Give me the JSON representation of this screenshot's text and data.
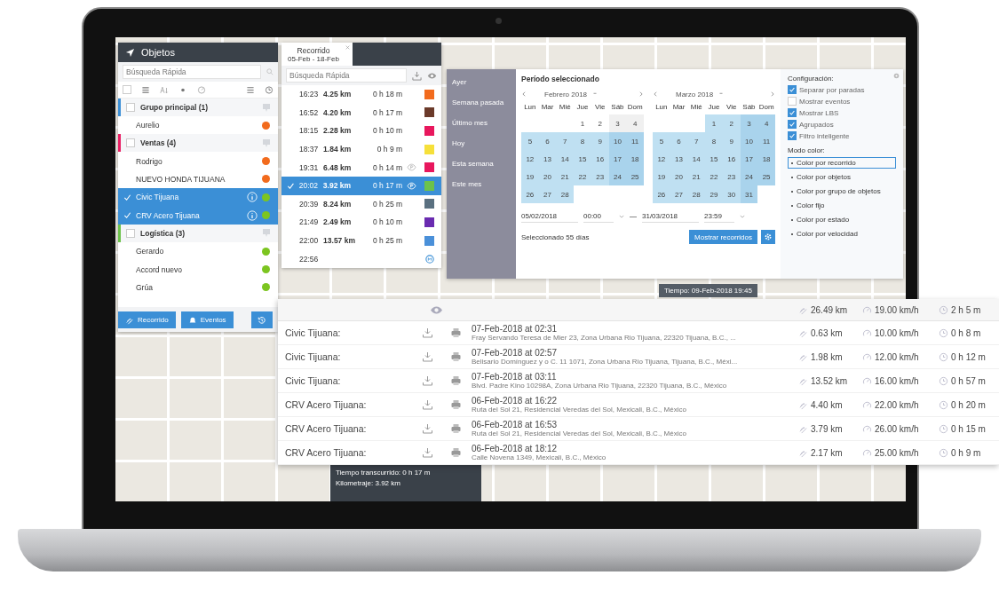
{
  "objects_panel": {
    "title": "Objetos",
    "search": {
      "placeholder": "Búsqueda Rápida"
    },
    "select_all": {
      "checked": false
    },
    "groups": [
      {
        "name": "Grupo principal (1)",
        "color": "#3b8fd6",
        "checked": false,
        "children": [
          {
            "name": "Aurelio",
            "color": "#f26b1d",
            "selected": false
          }
        ]
      },
      {
        "name": "Ventas (4)",
        "color": "#e91e63",
        "checked": false,
        "children": [
          {
            "name": "Rodrigo",
            "color": "#f26b1d",
            "selected": false
          },
          {
            "name": "NUEVO HONDA TIJUANA",
            "color": "#f26b1d",
            "selected": false
          },
          {
            "name": "Civic Tijuana",
            "color": "#7cc520",
            "selected": true
          },
          {
            "name": "CRV Acero Tijuana",
            "color": "#7cc520",
            "selected": true
          }
        ]
      },
      {
        "name": "Logística (3)",
        "color": "#6cc24a",
        "checked": false,
        "children": [
          {
            "name": "Gerardo",
            "color": "#7cc520",
            "selected": false
          },
          {
            "name": "Accord nuevo",
            "color": "#7cc520",
            "selected": false
          },
          {
            "name": "Grúa",
            "color": "#7cc520",
            "selected": false
          }
        ]
      }
    ],
    "buttons": [
      "Recorrido",
      "Eventos"
    ]
  },
  "route_panel": {
    "tab": {
      "title": "Recorrido",
      "subtitle": "05-Feb - 18-Feb"
    },
    "search": {
      "placeholder": "Búsqueda Rápida"
    },
    "rows": [
      {
        "kind": "trip",
        "time": "16:23",
        "distance": "4.25 km",
        "duration": "0 h 18 m",
        "color": "#f26b1d",
        "selected": false,
        "stop_icon": false
      },
      {
        "kind": "trip",
        "time": "16:52",
        "distance": "4.20 km",
        "duration": "0 h 17 m",
        "color": "#6b3a2a",
        "selected": false,
        "stop_icon": false
      },
      {
        "kind": "trip",
        "time": "18:15",
        "distance": "2.28 km",
        "duration": "0 h 10 m",
        "color": "#e8175d",
        "selected": false,
        "stop_icon": false
      },
      {
        "kind": "trip",
        "time": "18:37",
        "distance": "1.84 km",
        "duration": "0 h 9 m",
        "color": "#f6e03a",
        "selected": false,
        "stop_icon": false
      },
      {
        "kind": "trip",
        "time": "19:31",
        "distance": "6.48 km",
        "duration": "0 h 14 m",
        "color": "#e8175d",
        "selected": false,
        "stop_icon": true
      },
      {
        "kind": "trip",
        "time": "20:02",
        "distance": "3.92 km",
        "duration": "0 h 17 m",
        "color": "#6cc24a",
        "selected": true,
        "stop_icon": true
      },
      {
        "kind": "trip",
        "time": "20:39",
        "distance": "8.24 km",
        "duration": "0 h 25 m",
        "color": "#5a7080",
        "selected": false,
        "stop_icon": false
      },
      {
        "kind": "trip",
        "time": "21:49",
        "distance": "2.49 km",
        "duration": "0 h 10 m",
        "color": "#6a2bb0",
        "selected": false,
        "stop_icon": false
      },
      {
        "kind": "trip",
        "time": "22:00",
        "distance": "13.57 km",
        "duration": "0 h 25 m",
        "color": "#4a90d9",
        "selected": false,
        "stop_icon": false
      },
      {
        "kind": "end",
        "time": "22:56"
      }
    ]
  },
  "date_picker": {
    "presets": [
      "Ayer",
      "Semana pasada",
      "Último mes",
      "Hoy",
      "Esta semana",
      "Este mes"
    ],
    "title": "Período seleccionado",
    "months": [
      {
        "name": "Febrero 2018",
        "weekdays": [
          "Lun",
          "Mar",
          "Mié",
          "Jue",
          "Vie",
          "Sáb",
          "Dom"
        ],
        "weeks": [
          [
            {
              "day": "1",
              "in_range": false
            },
            {
              "day": "2",
              "in_range": false
            },
            {
              "day": "3",
              "in_range": false
            },
            {
              "day": "4",
              "in_range": false
            }
          ],
          [
            {
              "day": "5",
              "in_range": true
            },
            {
              "day": "6",
              "in_range": true
            },
            {
              "day": "7",
              "in_range": true
            },
            {
              "day": "8",
              "in_range": true
            },
            {
              "day": "9",
              "in_range": true
            },
            {
              "day": "10",
              "in_range": true
            },
            {
              "day": "11",
              "in_range": true
            }
          ],
          [
            {
              "day": "12",
              "in_range": true
            },
            {
              "day": "13",
              "in_range": true
            },
            {
              "day": "14",
              "in_range": true
            },
            {
              "day": "15",
              "in_range": true
            },
            {
              "day": "16",
              "in_range": true
            },
            {
              "day": "17",
              "in_range": true
            },
            {
              "day": "18",
              "in_range": true
            }
          ],
          [
            {
              "day": "19",
              "in_range": true
            },
            {
              "day": "20",
              "in_range": true
            },
            {
              "day": "21",
              "in_range": true
            },
            {
              "day": "22",
              "in_range": true
            },
            {
              "day": "23",
              "in_range": true
            },
            {
              "day": "24",
              "in_range": true
            },
            {
              "day": "25",
              "in_range": true
            }
          ],
          [
            {
              "day": "26",
              "in_range": true
            },
            {
              "day": "27",
              "in_range": true
            },
            {
              "day": "28",
              "in_range": true
            }
          ]
        ]
      },
      {
        "name": "Marzo 2018",
        "weekdays": [
          "Lun",
          "Mar",
          "Mié",
          "Jue",
          "Vie",
          "Sáb",
          "Dom"
        ],
        "weeks": [
          [
            {
              "day": "1",
              "in_range": true
            },
            {
              "day": "2",
              "in_range": true
            },
            {
              "day": "3",
              "in_range": true
            },
            {
              "day": "4",
              "in_range": true
            }
          ],
          [
            {
              "day": "5",
              "in_range": true
            },
            {
              "day": "6",
              "in_range": true
            },
            {
              "day": "7",
              "in_range": true
            },
            {
              "day": "8",
              "in_range": true
            },
            {
              "day": "9",
              "in_range": true
            },
            {
              "day": "10",
              "in_range": true
            },
            {
              "day": "11",
              "in_range": true
            }
          ],
          [
            {
              "day": "12",
              "in_range": true
            },
            {
              "day": "13",
              "in_range": true
            },
            {
              "day": "14",
              "in_range": true
            },
            {
              "day": "15",
              "in_range": true
            },
            {
              "day": "16",
              "in_range": true
            },
            {
              "day": "17",
              "in_range": true
            },
            {
              "day": "18",
              "in_range": true
            }
          ],
          [
            {
              "day": "19",
              "in_range": true
            },
            {
              "day": "20",
              "in_range": true
            },
            {
              "day": "21",
              "in_range": true
            },
            {
              "day": "22",
              "in_range": true
            },
            {
              "day": "23",
              "in_range": true
            },
            {
              "day": "24",
              "in_range": true
            },
            {
              "day": "25",
              "in_range": true
            }
          ],
          [
            {
              "day": "26",
              "in_range": true
            },
            {
              "day": "27",
              "in_range": true
            },
            {
              "day": "28",
              "in_range": true
            },
            {
              "day": "29",
              "in_range": true
            },
            {
              "day": "30",
              "in_range": true
            },
            {
              "day": "31",
              "in_range": true
            }
          ]
        ]
      }
    ],
    "start": {
      "date": "05/02/2018",
      "time": "00:00"
    },
    "end": {
      "date": "31/03/2018",
      "time": "23:59"
    },
    "summary": "Seleccionado 55 días",
    "button": "Mostrar recorridos",
    "config": {
      "title": "Configuración:",
      "options": [
        {
          "label": "Separar por paradas",
          "checked": true
        },
        {
          "label": "Mostrar eventos",
          "checked": false
        },
        {
          "label": "Mostrar LBS",
          "checked": true
        },
        {
          "label": "Agrupados",
          "checked": true
        },
        {
          "label": "Filtro inteligente",
          "checked": true
        }
      ],
      "color_mode_title": "Modo color:",
      "color_modes": [
        {
          "label": "Color por recorrido",
          "selected": true
        },
        {
          "label": "Color por objetos",
          "selected": false
        },
        {
          "label": "Color por grupo de objetos",
          "selected": false
        },
        {
          "label": "Color fijo",
          "selected": false
        },
        {
          "label": "Color por estado",
          "selected": false
        },
        {
          "label": "Color por velocidad",
          "selected": false
        }
      ]
    }
  },
  "tooltip": "Tiempo: 09-Feb-2018 19:45",
  "trip_info": [
    "Tiempo transcurrido: 0 h 17 m",
    "Kilometraje: 3.92 km"
  ],
  "events_table": {
    "totals": {
      "distance": "26.49 km",
      "speed": "19.00 km/h",
      "duration": "2 h 5 m"
    },
    "rows": [
      {
        "object": "Civic Tijuana:",
        "date": "07-Feb-2018 at 02:31",
        "address": "Fray Servando Teresa de Mier 23, Zona Urbana Rio Tijuana, 22320 Tijuana, B.C., ...",
        "distance": "0.63 km",
        "speed": "10.00 km/h",
        "duration": "0 h 8 m"
      },
      {
        "object": "Civic Tijuana:",
        "date": "07-Feb-2018 at 02:57",
        "address": "Belisario Domínguez y o C. 11 1071, Zona Urbana Rio Tijuana, Tijuana, B.C., Méxi...",
        "distance": "1.98 km",
        "speed": "12.00 km/h",
        "duration": "0 h 12 m"
      },
      {
        "object": "Civic Tijuana:",
        "date": "07-Feb-2018 at 03:11",
        "address": "Blvd. Padre Kino 10298A, Zona Urbana Rio Tijuana, 22320 Tijuana, B.C., México",
        "distance": "13.52 km",
        "speed": "16.00 km/h",
        "duration": "0 h 57 m"
      },
      {
        "object": "CRV Acero Tijuana:",
        "date": "06-Feb-2018 at 16:22",
        "address": "Ruta del Sol 21, Residencial Veredas del Sol, Mexicali, B.C., México",
        "distance": "4.40 km",
        "speed": "22.00 km/h",
        "duration": "0 h 20 m"
      },
      {
        "object": "CRV Acero Tijuana:",
        "date": "06-Feb-2018 at 16:53",
        "address": "Ruta del Sol 21, Residencial Veredas del Sol, Mexicali, B.C., México",
        "distance": "3.79 km",
        "speed": "26.00 km/h",
        "duration": "0 h 15 m"
      },
      {
        "object": "CRV Acero Tijuana:",
        "date": "06-Feb-2018 at 18:12",
        "address": "Calle Novena 1349, Mexicali, B.C., México",
        "distance": "2.17 km",
        "speed": "25.00 km/h",
        "duration": "0 h 9 m"
      }
    ]
  }
}
